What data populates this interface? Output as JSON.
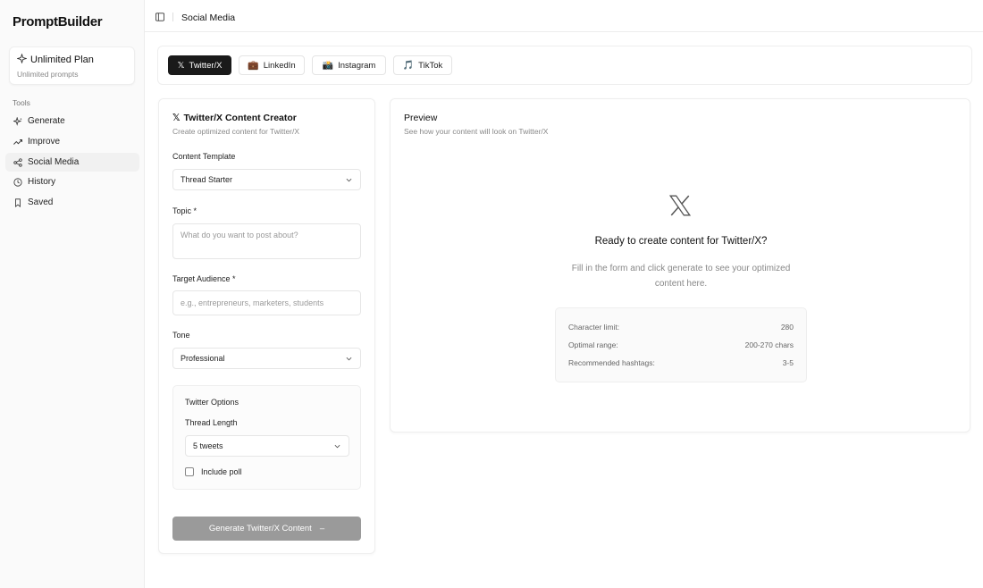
{
  "sidebar": {
    "logo": "PromptBuilder",
    "plan": {
      "title": "Unlimited Plan",
      "subtitle": "Unlimited prompts",
      "icon": "sparkle-icon"
    },
    "tools_label": "Tools",
    "items": [
      {
        "label": "Generate",
        "icon": "sparkles-icon",
        "active": false
      },
      {
        "label": "Improve",
        "icon": "trending-up-icon",
        "active": false
      },
      {
        "label": "Social Media",
        "icon": "share-icon",
        "active": true
      },
      {
        "label": "History",
        "icon": "clock-icon",
        "active": false
      },
      {
        "label": "Saved",
        "icon": "bookmark-icon",
        "active": false
      }
    ]
  },
  "header": {
    "title": "Social Media",
    "toggle_icon": "sidebar-toggle-icon"
  },
  "tabs": [
    {
      "label": "Twitter/X",
      "glyph": "𝕏",
      "active": true
    },
    {
      "label": "LinkedIn",
      "glyph": "💼",
      "active": false
    },
    {
      "label": "Instagram",
      "glyph": "📸",
      "active": false
    },
    {
      "label": "TikTok",
      "glyph": "🎵",
      "active": false
    }
  ],
  "form": {
    "title": "Twitter/X Content Creator",
    "subtitle": "Create optimized content for Twitter/X",
    "template_label": "Content Template",
    "template_value": "Thread Starter",
    "topic_label": "Topic *",
    "topic_placeholder": "What do you want to post about?",
    "audience_label": "Target Audience *",
    "audience_placeholder": "e.g., entrepreneurs, marketers, students",
    "tone_label": "Tone",
    "tone_value": "Professional",
    "options": {
      "title": "Twitter Options",
      "thread_length_label": "Thread Length",
      "thread_length_value": "5 tweets",
      "poll_label": "Include poll",
      "poll_checked": false
    },
    "generate_label": "Generate Twitter/X Content"
  },
  "preview": {
    "title": "Preview",
    "subtitle": "See how your content will look on Twitter/X",
    "ready_text": "Ready to create content for Twitter/X?",
    "fill_text": "Fill in the form and click generate to see your optimized content here.",
    "stats": [
      {
        "label": "Character limit:",
        "value": "280"
      },
      {
        "label": "Optimal range:",
        "value": "200-270 chars"
      },
      {
        "label": "Recommended hashtags:",
        "value": "3-5"
      }
    ]
  },
  "colors": {
    "active_tab": "#1a1a1a",
    "button_disabled": "#9a9a9a",
    "sidebar_bg": "#fafafa"
  }
}
